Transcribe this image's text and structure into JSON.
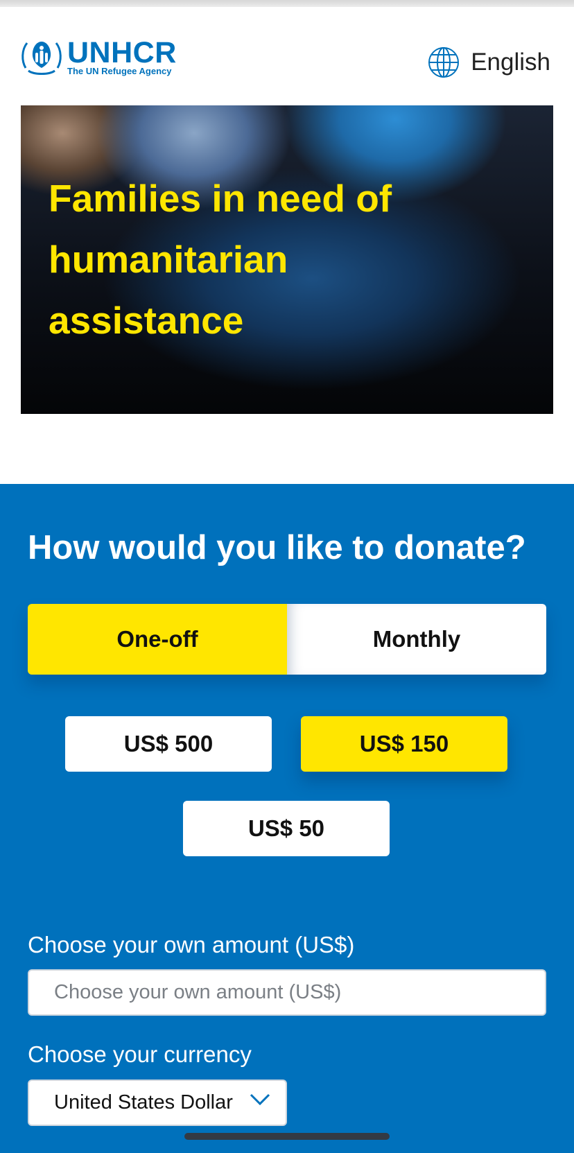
{
  "header": {
    "logo": {
      "name": "UNHCR",
      "tagline": "The UN Refugee Agency"
    },
    "language": {
      "label": "English",
      "icon": "globe-icon"
    }
  },
  "hero": {
    "title": "Families in need of humanitarian assistance"
  },
  "donate": {
    "title": "How would you like to donate?",
    "frequency": {
      "options": [
        "One-off",
        "Monthly"
      ],
      "selected": "One-off"
    },
    "amounts": {
      "options": [
        "US$ 500",
        "US$ 150",
        "US$ 50"
      ],
      "selected": "US$ 150"
    },
    "custom_amount": {
      "label": "Choose your own amount (US$)",
      "placeholder": "Choose your own amount (US$)"
    },
    "currency": {
      "label": "Choose your currency",
      "value": "United States Dollar"
    }
  },
  "colors": {
    "brand_blue": "#0071bc",
    "accent_yellow": "#ffe600",
    "white": "#ffffff"
  }
}
